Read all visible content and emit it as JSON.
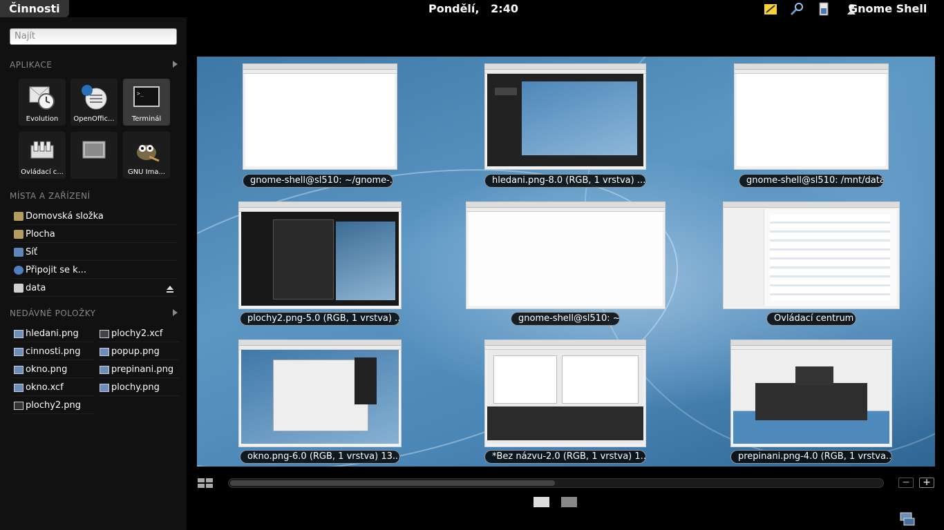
{
  "panel": {
    "activities_label": "Činnosti",
    "clock": "Pondělí,   2:40",
    "user_label": "Gnome Shell",
    "tray_icons": [
      "notes-icon",
      "search-tool-icon",
      "battery-icon",
      "user-icon"
    ]
  },
  "sidebar": {
    "search_placeholder": "Najít",
    "apps_heading": "APLIKACE",
    "apps": [
      {
        "label": "Evolution",
        "icon": "evolution-icon"
      },
      {
        "label": "OpenOffic...",
        "icon": "openoffice-icon"
      },
      {
        "label": "Terminál",
        "icon": "terminal-icon"
      },
      {
        "label": "Ovládací c...",
        "icon": "control-center-icon"
      },
      {
        "label": "",
        "icon": "display-icon"
      },
      {
        "label": "GNU Ima...",
        "icon": "gimp-icon"
      }
    ],
    "places_heading": "MÍSTA A ZAŘÍZENÍ",
    "places": [
      {
        "label": "Domovská složka",
        "icon": "home-folder-icon"
      },
      {
        "label": "Plocha",
        "icon": "desktop-folder-icon"
      },
      {
        "label": "Síť",
        "icon": "network-icon"
      },
      {
        "label": "Připojit se k...",
        "icon": "connect-server-icon"
      },
      {
        "label": "data",
        "icon": "drive-icon"
      }
    ],
    "recent_heading": "NEDÁVNÉ POLOŽKY",
    "recent": [
      {
        "label": "hledani.png"
      },
      {
        "label": "plochy2.xcf"
      },
      {
        "label": "cinnosti.png"
      },
      {
        "label": "popup.png"
      },
      {
        "label": "okno.png"
      },
      {
        "label": "prepinani.png"
      },
      {
        "label": "okno.xcf"
      },
      {
        "label": "plochy.png"
      },
      {
        "label": "plochy2.png"
      }
    ]
  },
  "windows": [
    {
      "caption": "gnome-shell@sl510: ~/gnome-...",
      "kind": "terminal"
    },
    {
      "caption": "hledani.png-8.0 (RGB, 1 vrstva) ...",
      "kind": "gimp-dark"
    },
    {
      "caption": "gnome-shell@sl510: /mnt/data",
      "kind": "terminal"
    },
    {
      "caption": "plochy2.png-5.0 (RGB, 1 vrstva) ...",
      "kind": "gimp-dark"
    },
    {
      "caption": "gnome-shell@sl510: ~",
      "kind": "terminal"
    },
    {
      "caption": "Ovládací centrum",
      "kind": "control-center"
    },
    {
      "caption": "okno.png-6.0 (RGB, 1 vrstva) 13...",
      "kind": "gimp-blue"
    },
    {
      "caption": "*Bez názvu-2.0 (RGB, 1 vrstva) 1...",
      "kind": "gimp-blue"
    },
    {
      "caption": "prepinani.png-4.0 (RGB, 1 vrstva...",
      "kind": "gimp-blue"
    }
  ],
  "controls": {
    "zoom_out": "−",
    "zoom_in": "+"
  }
}
